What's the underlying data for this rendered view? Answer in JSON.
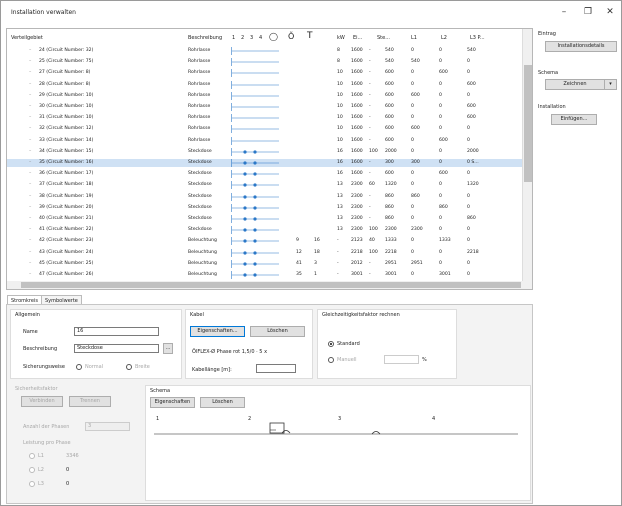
{
  "title": "Installation verwalten",
  "window": {
    "minimize": "–",
    "restore": "❐",
    "close": "✕"
  },
  "table": {
    "headers": {
      "name": "Verteilgebiet",
      "type": "Beschreibung",
      "p1": "1",
      "p2": "2",
      "p3": "3",
      "p4": "4",
      "sym1": "◯",
      "sym2": "Ŏ",
      "sym3": "T",
      "c1": "kW",
      "c2": "Ei...",
      "c3": "Ste...",
      "c4": "L1",
      "c5": "L2",
      "c6": "L3 P..."
    },
    "rows": [
      {
        "name": "24 (Circuit Number: 32)",
        "type": "Rohrlasse",
        "v1": "8",
        "v2": "1600",
        "v3": "-",
        "v4": "540",
        "v5": "0",
        "v6": "0",
        "v7": "540"
      },
      {
        "name": "25 (Circuit Number: 75)",
        "type": "Rohrlasse",
        "v1": "8",
        "v2": "1600",
        "v3": "-",
        "v4": "540",
        "v5": "540",
        "v6": "0",
        "v7": "0"
      },
      {
        "name": "27 (Circuit Number: 8)",
        "type": "Rohrlasse",
        "v1": "10",
        "v2": "1600",
        "v3": "-",
        "v4": "600",
        "v5": "0",
        "v6": "600",
        "v7": "0"
      },
      {
        "name": "28 (Circuit Number: 8)",
        "type": "Rohrlasse",
        "v1": "10",
        "v2": "1600",
        "v3": "-",
        "v4": "600",
        "v5": "0",
        "v6": "0",
        "v7": "600"
      },
      {
        "name": "29 (Circuit Number: 10)",
        "type": "Rohrlasse",
        "v1": "10",
        "v2": "1600",
        "v3": "-",
        "v4": "600",
        "v5": "600",
        "v6": "0",
        "v7": "0"
      },
      {
        "name": "30 (Circuit Number: 10)",
        "type": "Rohrlasse",
        "v1": "10",
        "v2": "1600",
        "v3": "-",
        "v4": "600",
        "v5": "0",
        "v6": "0",
        "v7": "600"
      },
      {
        "name": "31 (Circuit Number: 10)",
        "type": "Rohrlasse",
        "v1": "10",
        "v2": "1600",
        "v3": "-",
        "v4": "600",
        "v5": "0",
        "v6": "0",
        "v7": "600"
      },
      {
        "name": "32 (Circuit Number: 12)",
        "type": "Rohrlasse",
        "v1": "10",
        "v2": "1600",
        "v3": "-",
        "v4": "600",
        "v5": "600",
        "v6": "0",
        "v7": "0"
      },
      {
        "name": "33 (Circuit Number: 14)",
        "type": "Rohrlasse",
        "v1": "10",
        "v2": "1600",
        "v3": "-",
        "v4": "600",
        "v5": "0",
        "v6": "600",
        "v7": "0"
      },
      {
        "name": "34 (Circuit Number: 15)",
        "type": "Steckdose",
        "v1": "16",
        "v2": "1600",
        "v3": "100",
        "v4": "2000",
        "v5": "0",
        "v6": "0",
        "v7": "2000"
      },
      {
        "name": "35 (Circuit Number: 16)",
        "type": "Steckdose",
        "v1": "16",
        "v2": "1600",
        "v3": "-",
        "v4": "300",
        "v5": "300",
        "v6": "0",
        "v7": "0 S..."
      },
      {
        "name": "36 (Circuit Number: 17)",
        "type": "Steckdose",
        "v1": "16",
        "v2": "1600",
        "v3": "-",
        "v4": "600",
        "v5": "0",
        "v6": "600",
        "v7": "0"
      },
      {
        "name": "37 (Circuit Number: 18)",
        "type": "Steckdose",
        "v1": "13",
        "v2": "2300",
        "v3": "60",
        "v4": "1320",
        "v5": "0",
        "v6": "0",
        "v7": "1320"
      },
      {
        "name": "38 (Circuit Number: 19)",
        "type": "Steckdose",
        "v1": "13",
        "v2": "2300",
        "v3": "-",
        "v4": "860",
        "v5": "860",
        "v6": "0",
        "v7": "0"
      },
      {
        "name": "39 (Circuit Number: 20)",
        "type": "Steckdose",
        "v1": "13",
        "v2": "2300",
        "v3": "-",
        "v4": "860",
        "v5": "0",
        "v6": "860",
        "v7": "0"
      },
      {
        "name": "40 (Circuit Number: 21)",
        "type": "Steckdose",
        "v1": "13",
        "v2": "2300",
        "v3": "-",
        "v4": "860",
        "v5": "0",
        "v6": "0",
        "v7": "860"
      },
      {
        "name": "41 (Circuit Number: 22)",
        "type": "Steckdose",
        "v1": "13",
        "v2": "2300",
        "v3": "100",
        "v4": "2300",
        "v5": "2300",
        "v6": "0",
        "v7": "0"
      },
      {
        "name": "42 (Circuit Number: 23)",
        "type": "Beleuchtung",
        "e1": "9",
        "e2": "16",
        "v1": "-",
        "v2": "2123",
        "v3": "40",
        "v4": "1333",
        "v5": "0",
        "v6": "1333",
        "v7": "0"
      },
      {
        "name": "43 (Circuit Number: 24)",
        "type": "Beleuchtung",
        "e1": "12",
        "e2": "18",
        "v1": "-",
        "v2": "2218",
        "v3": "100",
        "v4": "2218",
        "v5": "0",
        "v6": "0",
        "v7": "2218"
      },
      {
        "name": "45 (Circuit Number: 25)",
        "type": "Beleuchtung",
        "e1": "41",
        "e2": "3",
        "v1": "-",
        "v2": "2012",
        "v3": "-",
        "v4": "2951",
        "v5": "2951",
        "v6": "0",
        "v7": "0"
      },
      {
        "name": "47 (Circuit Number: 26)",
        "type": "Beleuchtung",
        "e1": "35",
        "e2": "1",
        "v1": "-",
        "v2": "3001",
        "v3": "-",
        "v4": "3001",
        "v5": "0",
        "v6": "3001",
        "v7": "0"
      }
    ]
  },
  "tabs": [
    "Stromkreis",
    "Symbolwerte"
  ],
  "allgemein": {
    "title": "Allgemein",
    "name_label": "Name",
    "name_value": "16",
    "desc_label": "Beschreibung",
    "desc_value": "Steckdose",
    "dots": "...",
    "sicherung_label": "Sicherungsweise",
    "opt1": "Normal",
    "opt2": "Breite"
  },
  "kabel": {
    "title": "Kabel",
    "btn_primary": "Eigenschaften...",
    "btn_delete": "Löschen",
    "cable_desc": "ÖlFLEX-Ø Phase rot 1,5/0 · 5 x",
    "kabelfläche_label": "Kabellänge [m]:"
  },
  "gleich": {
    "title": "Gleichzeitigkeitsfaktor rechnen",
    "opt_standard": "Standard",
    "opt_manual": "Manuell",
    "percent": "%"
  },
  "sub": {
    "title": "Sicherheitsfaktor",
    "btn1": "Verbinden",
    "btn2": "Trennen",
    "phase_label": "Anzahl der Phasen",
    "phase_value": "3",
    "leistung_label": "Leistung pro Phase",
    "opt1": "L1",
    "val1": "3346",
    "opt2": "L2",
    "val2": "0",
    "opt3": "L3",
    "val3": "0"
  },
  "schema": {
    "title": "Schema",
    "btn1": "Eigenschaften",
    "btn2": "Löschen",
    "tick1": "1",
    "tick2": "2",
    "tick3": "3",
    "tick4": "4"
  },
  "right": {
    "g1": "Eintrag",
    "b1": "Installationsdetails",
    "g2": "Schema",
    "b2": "Zeichnen",
    "arrow": "▾",
    "g3": "Installation",
    "b3": "Einfügen..."
  },
  "colors": {
    "accent": "#0078d7",
    "selected": "#cfe1f4"
  }
}
